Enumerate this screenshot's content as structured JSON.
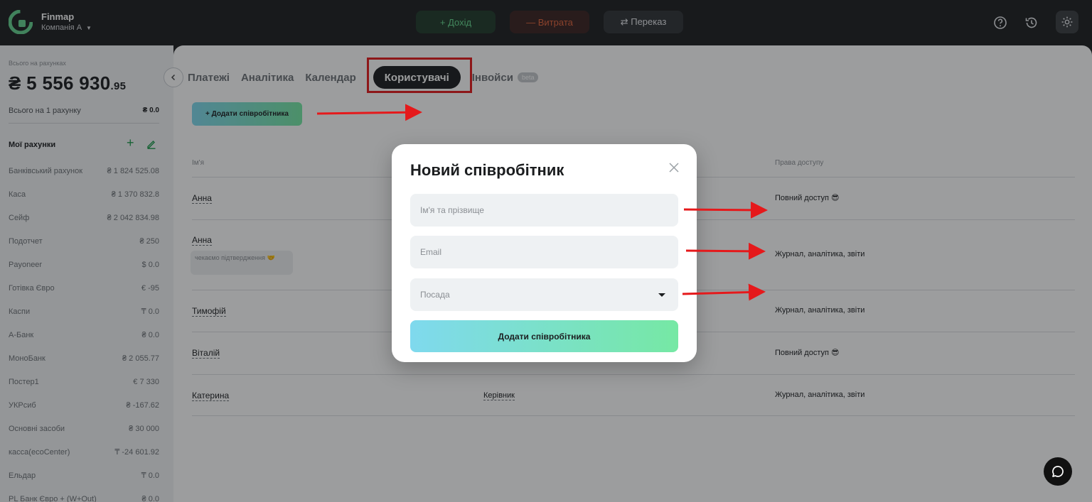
{
  "header": {
    "brand": "Finmap",
    "company": "Компанія А",
    "income_label": "+ Дохід",
    "expense_label": "— Витрата",
    "transfer_label": "⇄ Переказ",
    "colors": {
      "income": "#66d98f",
      "expense": "#e0623a",
      "bar": "#1c1e20"
    }
  },
  "sidebar": {
    "total_label": "Всього на рахунках",
    "total_main": "₴ 5 556 930",
    "total_cents": ".95",
    "per_account_label": "Всього на 1 рахунку",
    "per_account_value": "₴ 0.0",
    "my_accounts_title": "Мої рахунки",
    "accounts": [
      {
        "name": "Банківський рахунок",
        "amount": "₴ 1 824 525.08"
      },
      {
        "name": "Каса",
        "amount": "₴ 1 370 832.8"
      },
      {
        "name": "Сейф",
        "amount": "₴ 2 042 834.98"
      },
      {
        "name": "Подотчет",
        "amount": "₴ 250"
      },
      {
        "name": "Payoneer",
        "amount": "$ 0.0"
      },
      {
        "name": "Готівка Євро",
        "amount": "€ -95"
      },
      {
        "name": "Каспи",
        "amount": "₸ 0.0"
      },
      {
        "name": "А-Банк",
        "amount": "₴ 0.0"
      },
      {
        "name": "МоноБанк",
        "amount": "₴ 2 055.77"
      },
      {
        "name": "Постер1",
        "amount": "€ 7 330"
      },
      {
        "name": "УКРсиб",
        "amount": "₴ -167.62"
      },
      {
        "name": "Основні засоби",
        "amount": "₴ 30 000"
      },
      {
        "name": "касса(ecoCenter)",
        "amount": "₸ -24 601.92"
      },
      {
        "name": "Ельдар",
        "amount": "₸ 0.0"
      },
      {
        "name": "PL Банк Євро + (W+Out)",
        "amount": "₴ 0.0"
      }
    ]
  },
  "tabs": {
    "items": [
      "Платежі",
      "Аналітика",
      "Календар"
    ],
    "active": "Користувачі",
    "invoice": "Інвойси",
    "beta": "beta"
  },
  "users": {
    "add_button": "+ Додати співробітника",
    "columns": {
      "name": "Ім'я",
      "access": "Права доступу"
    },
    "rows": [
      {
        "name": "Анна",
        "role": "",
        "access": "Повний доступ 😎",
        "pending": ""
      },
      {
        "name": "Анна",
        "role": "",
        "access": "Журнал, аналітика, звіти",
        "pending": "чекаємо підтвердження 🤝"
      },
      {
        "name": "Тимофій",
        "role": "",
        "access": "Журнал, аналітика, звіти",
        "pending": ""
      },
      {
        "name": "Віталій",
        "role": "",
        "access": "Повний доступ 😎",
        "pending": ""
      },
      {
        "name": "Катерина",
        "role": "Керівник",
        "access": "Журнал, аналітика, звіти",
        "pending": ""
      }
    ]
  },
  "modal": {
    "title": "Новий співробітник",
    "name_placeholder": "Ім'я та прізвище",
    "email_placeholder": "Email",
    "position_placeholder": "Посада",
    "submit_label": "Додати співробітника"
  },
  "icons": {
    "logo": "finmap-logo-icon",
    "help": "question-circle-icon",
    "history": "history-icon",
    "settings": "gear-icon",
    "chat": "chat-bubble-icon",
    "close": "close-icon",
    "collapse": "chevron-left-icon"
  }
}
